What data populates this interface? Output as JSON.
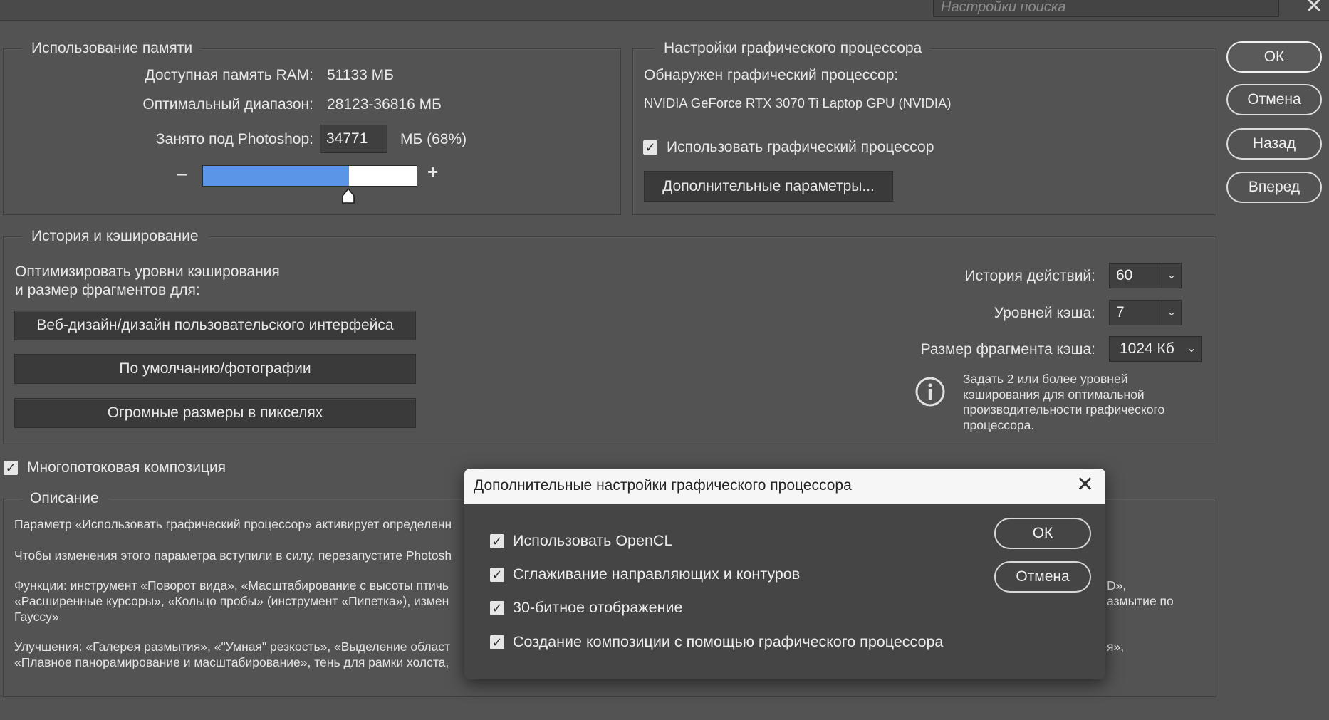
{
  "search": {
    "placeholder": "Настройки поиска"
  },
  "buttons": {
    "ok": "ОК",
    "cancel": "Отмена",
    "back": "Назад",
    "forward": "Вперед"
  },
  "memory": {
    "legend": "Использование памяти",
    "available_label": "Доступная память RAM:",
    "available_value": "51133 МБ",
    "optimal_label": "Оптимальный диапазон:",
    "optimal_value": "28123-36816 МБ",
    "used_label": "Занято под Photoshop:",
    "used_value": "34771",
    "used_suffix": "МБ (68%)",
    "minus": "–",
    "plus": "+",
    "slider_fraction": 0.68
  },
  "gpu": {
    "legend": "Настройки графического процессора",
    "detected_label": "Обнаружен графический процессор:",
    "gpu_name": "NVIDIA GeForce RTX 3070 Ti Laptop GPU (NVIDIA)",
    "use_gpu_label": "Использовать графический процессор",
    "advanced_button": "Дополнительные параметры..."
  },
  "history": {
    "legend": "История и кэширование",
    "optimize_line1": "Оптимизировать уровни кэширования",
    "optimize_line2": "и размер фрагментов для:",
    "preset_web": "Веб-дизайн/дизайн пользовательского интерфейса",
    "preset_default": "По умолчанию/фотографии",
    "preset_huge": "Огромные размеры в пикселях",
    "history_states_label": "История действий:",
    "history_states_value": "60",
    "cache_levels_label": "Уровней кэша:",
    "cache_levels_value": "7",
    "tile_size_label": "Размер фрагмента кэша:",
    "tile_size_value": "1024 Кб",
    "info_text": [
      "Задать 2 или более уровней",
      "кэширования для оптимальной",
      "производительности графического",
      "процессора."
    ]
  },
  "multithread": {
    "label": "Многопотоковая композиция"
  },
  "description": {
    "legend": "Описание",
    "p1": "Параметр «Использовать графический процессор» активирует определенн",
    "p2": "Чтобы изменения этого параметра вступили в силу, перезапустите Photosh",
    "p3_line1": "Функции: инструмент «Поворот вида», «Масштабирование с высоты птичь",
    "p3_line1_tail": "D»,",
    "p3_line2": "«Расширенные курсоры», «Кольцо пробы» (инструмент «Пипетка»), измен",
    "p3_line2_tail": "азмытие по",
    "p3_line3": "Гауссу»",
    "p4_line1": "Улучшения: «Галерея размытия», «\"Умная\" резкость», «Выделение област",
    "p4_line1_tail": "я»,",
    "p4_line2": "«Плавное панорамирование и масштабирование», тень для рамки холста, "
  },
  "modal": {
    "title": "Дополнительные настройки графического процессора",
    "opencl": "Использовать OpenCL",
    "antialias": "Сглаживание направляющих и контуров",
    "display30": "30-битное отображение",
    "gpu_composite": "Создание композиции с помощью графического процессора",
    "ok": "ОК",
    "cancel": "Отмена"
  },
  "icons": {
    "check": "✓",
    "chevron": "⌄",
    "close": "✕",
    "info": "i"
  }
}
